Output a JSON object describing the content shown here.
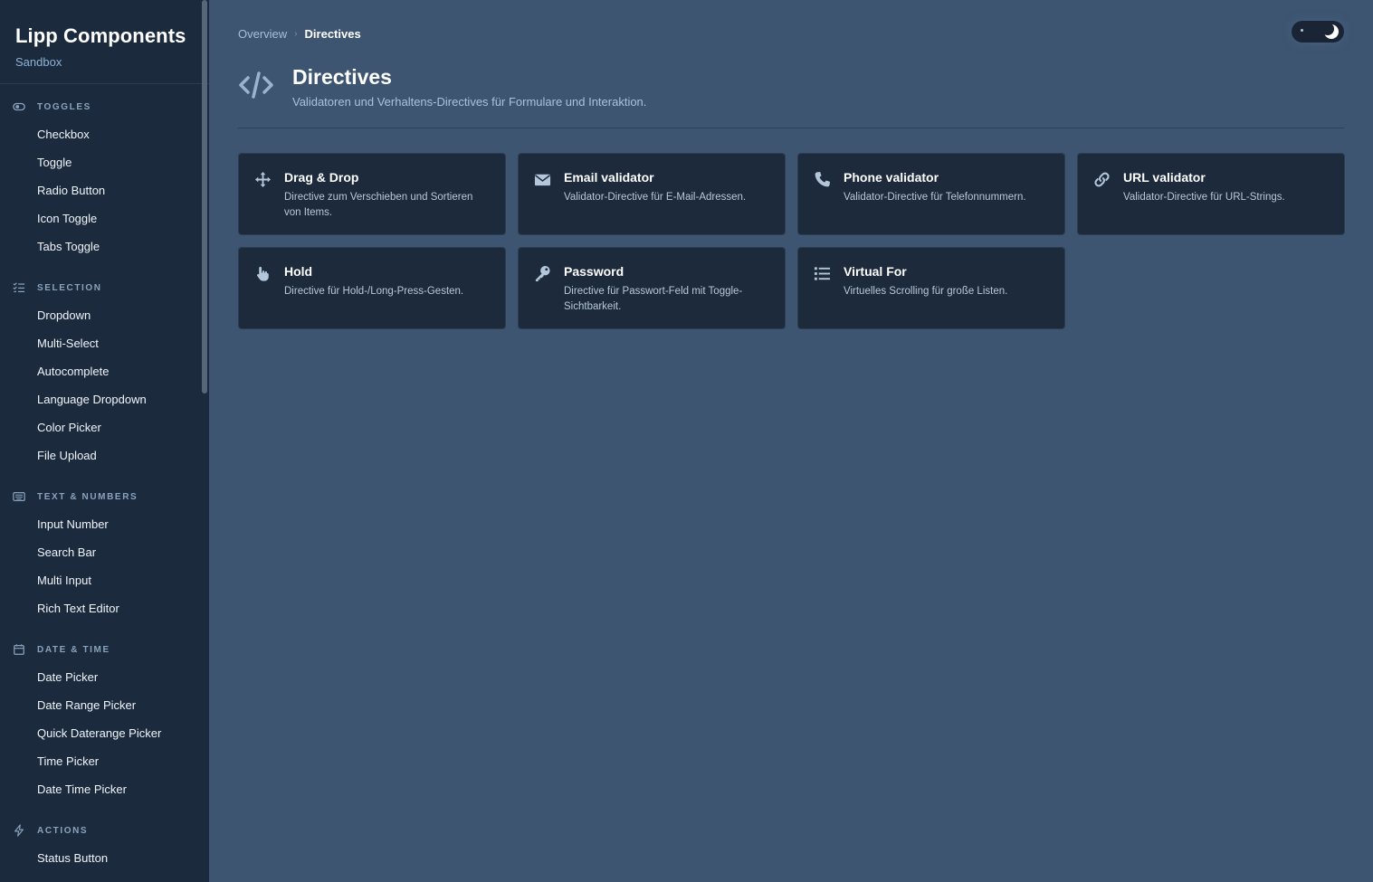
{
  "brand": {
    "title": "Lipp Components",
    "subtitle": "Sandbox"
  },
  "sidebar": {
    "sections": [
      {
        "label": "Toggles",
        "icon": "toggle-icon",
        "items": [
          "Checkbox",
          "Toggle",
          "Radio Button",
          "Icon Toggle",
          "Tabs Toggle"
        ]
      },
      {
        "label": "Selection",
        "icon": "list-check-icon",
        "items": [
          "Dropdown",
          "Multi-Select",
          "Autocomplete",
          "Language Dropdown",
          "Color Picker",
          "File Upload"
        ]
      },
      {
        "label": "Text & Numbers",
        "icon": "keyboard-icon",
        "items": [
          "Input Number",
          "Search Bar",
          "Multi Input",
          "Rich Text Editor"
        ]
      },
      {
        "label": "Date & Time",
        "icon": "calendar-icon",
        "items": [
          "Date Picker",
          "Date Range Picker",
          "Quick Daterange Picker",
          "Time Picker",
          "Date Time Picker"
        ]
      },
      {
        "label": "Actions",
        "icon": "bolt-icon",
        "items": [
          "Status Button"
        ]
      }
    ]
  },
  "breadcrumb": {
    "parent": "Overview",
    "separator": "›",
    "current": "Directives"
  },
  "page": {
    "title": "Directives",
    "description": "Validatoren und Verhaltens-Directives für Formulare und Interaktion.",
    "icon": "code-icon"
  },
  "cards": [
    {
      "title": "Drag & Drop",
      "description": "Directive zum Verschieben und Sortieren von Items.",
      "icon": "move-arrows-icon"
    },
    {
      "title": "Email validator",
      "description": "Validator-Directive für E-Mail-Adressen.",
      "icon": "envelope-icon"
    },
    {
      "title": "Phone validator",
      "description": "Validator-Directive für Telefonnummern.",
      "icon": "phone-icon"
    },
    {
      "title": "URL validator",
      "description": "Validator-Directive für URL-Strings.",
      "icon": "link-icon"
    },
    {
      "title": "Hold",
      "description": "Directive für Hold-/Long-Press-Gesten.",
      "icon": "pointer-hand-icon"
    },
    {
      "title": "Password",
      "description": "Directive für Passwort-Feld mit Toggle-Sichtbarkeit.",
      "icon": "key-icon"
    },
    {
      "title": "Virtual For",
      "description": "Virtuelles Scrolling für große Listen.",
      "icon": "list-icon"
    }
  ],
  "colors": {
    "background": "#3d5570",
    "sidebar": "#1b2a3d",
    "card": "#1c2a3c",
    "accent_text": "#8fb2d6"
  }
}
